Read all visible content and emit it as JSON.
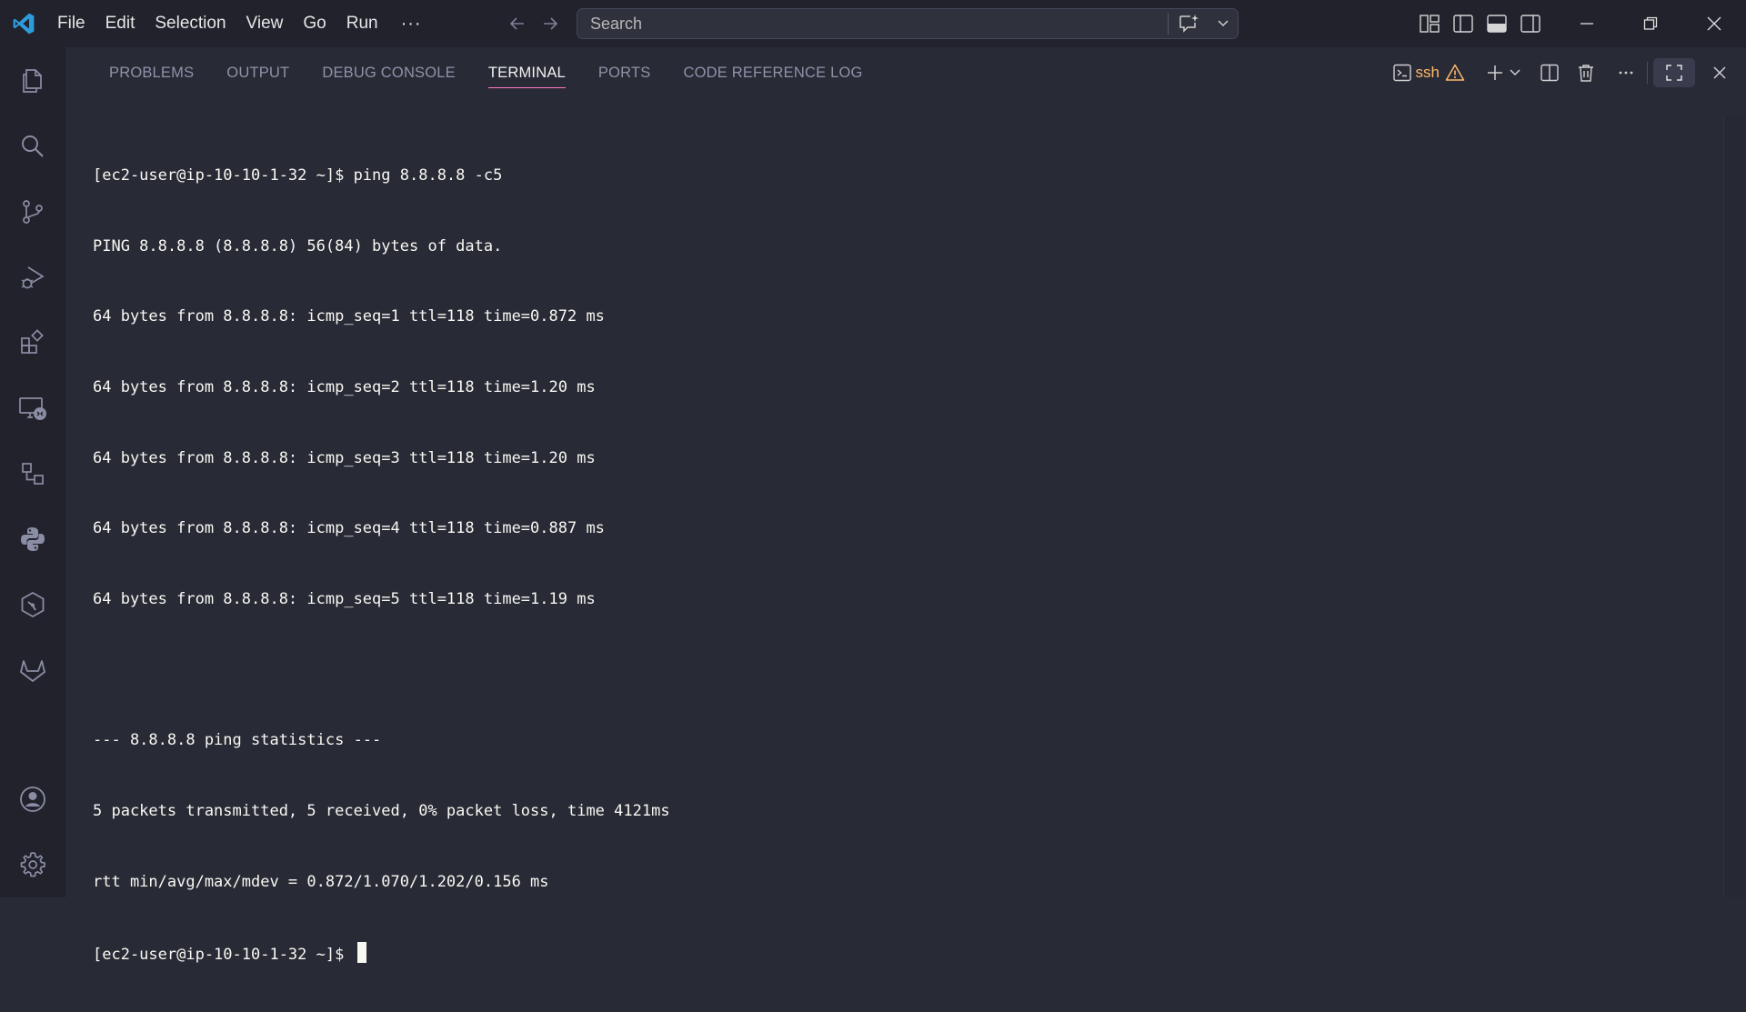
{
  "titlebar": {
    "menu": [
      "File",
      "Edit",
      "Selection",
      "View",
      "Go",
      "Run"
    ],
    "menu_more": "···",
    "search_placeholder": "Search"
  },
  "activitybar": {
    "items": [
      {
        "name": "explorer-icon"
      },
      {
        "name": "search-icon"
      },
      {
        "name": "source-control-icon"
      },
      {
        "name": "run-debug-icon"
      },
      {
        "name": "extensions-icon"
      },
      {
        "name": "remote-explorer-icon"
      },
      {
        "name": "references-icon"
      },
      {
        "name": "python-icon"
      },
      {
        "name": "kubernetes-icon"
      },
      {
        "name": "gitlab-icon"
      }
    ],
    "bottom": [
      {
        "name": "accounts-icon"
      },
      {
        "name": "settings-gear-icon"
      }
    ]
  },
  "panel": {
    "tabs": [
      "PROBLEMS",
      "OUTPUT",
      "DEBUG CONSOLE",
      "TERMINAL",
      "PORTS",
      "CODE REFERENCE LOG"
    ],
    "active_tab": "TERMINAL",
    "terminal_name": "ssh"
  },
  "terminal": {
    "lines": [
      "[ec2-user@ip-10-10-1-32 ~]$ ping 8.8.8.8 -c5",
      "PING 8.8.8.8 (8.8.8.8) 56(84) bytes of data.",
      "64 bytes from 8.8.8.8: icmp_seq=1 ttl=118 time=0.872 ms",
      "64 bytes from 8.8.8.8: icmp_seq=2 ttl=118 time=1.20 ms",
      "64 bytes from 8.8.8.8: icmp_seq=3 ttl=118 time=1.20 ms",
      "64 bytes from 8.8.8.8: icmp_seq=4 ttl=118 time=0.887 ms",
      "64 bytes from 8.8.8.8: icmp_seq=5 ttl=118 time=1.19 ms",
      "",
      "--- 8.8.8.8 ping statistics ---",
      "5 packets transmitted, 5 received, 0% packet loss, time 4121ms",
      "rtt min/avg/max/mdev = 0.872/1.070/1.202/0.156 ms"
    ],
    "prompt": "[ec2-user@ip-10-10-1-32 ~]$ "
  },
  "colors": {
    "accent": "#ff79c6",
    "warning": "#ffb86c",
    "vscode_blue": "#2d9cdb"
  }
}
